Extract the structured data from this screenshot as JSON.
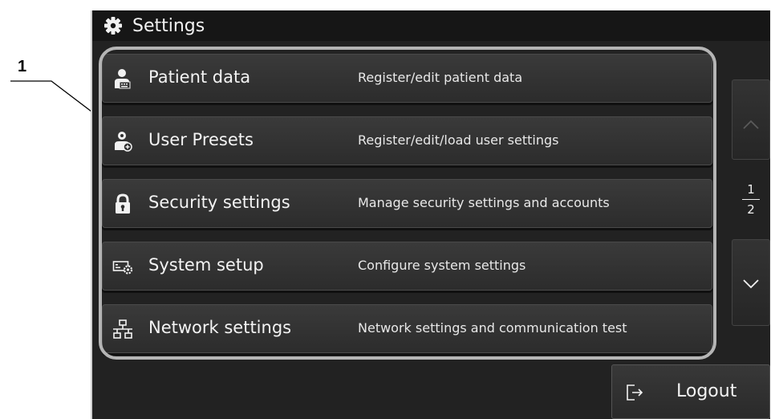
{
  "annotation": {
    "callout": "1"
  },
  "window": {
    "title": "Settings",
    "title_icon": "gear-icon"
  },
  "menu": [
    {
      "label": "Patient data",
      "description": "Register/edit patient data",
      "icon": "patient-icon"
    },
    {
      "label": "User Presets",
      "description": "Register/edit/load user settings",
      "icon": "user-preset-icon"
    },
    {
      "label": "Security settings",
      "description": "Manage security settings and accounts",
      "icon": "lock-icon"
    },
    {
      "label": "System setup",
      "description": "Configure system settings",
      "icon": "system-setup-icon"
    },
    {
      "label": "Network settings",
      "description": "Network settings and communication test",
      "icon": "network-icon"
    }
  ],
  "pager": {
    "current": "1",
    "total": "2"
  },
  "logout": {
    "label": "Logout",
    "icon": "logout-icon"
  }
}
